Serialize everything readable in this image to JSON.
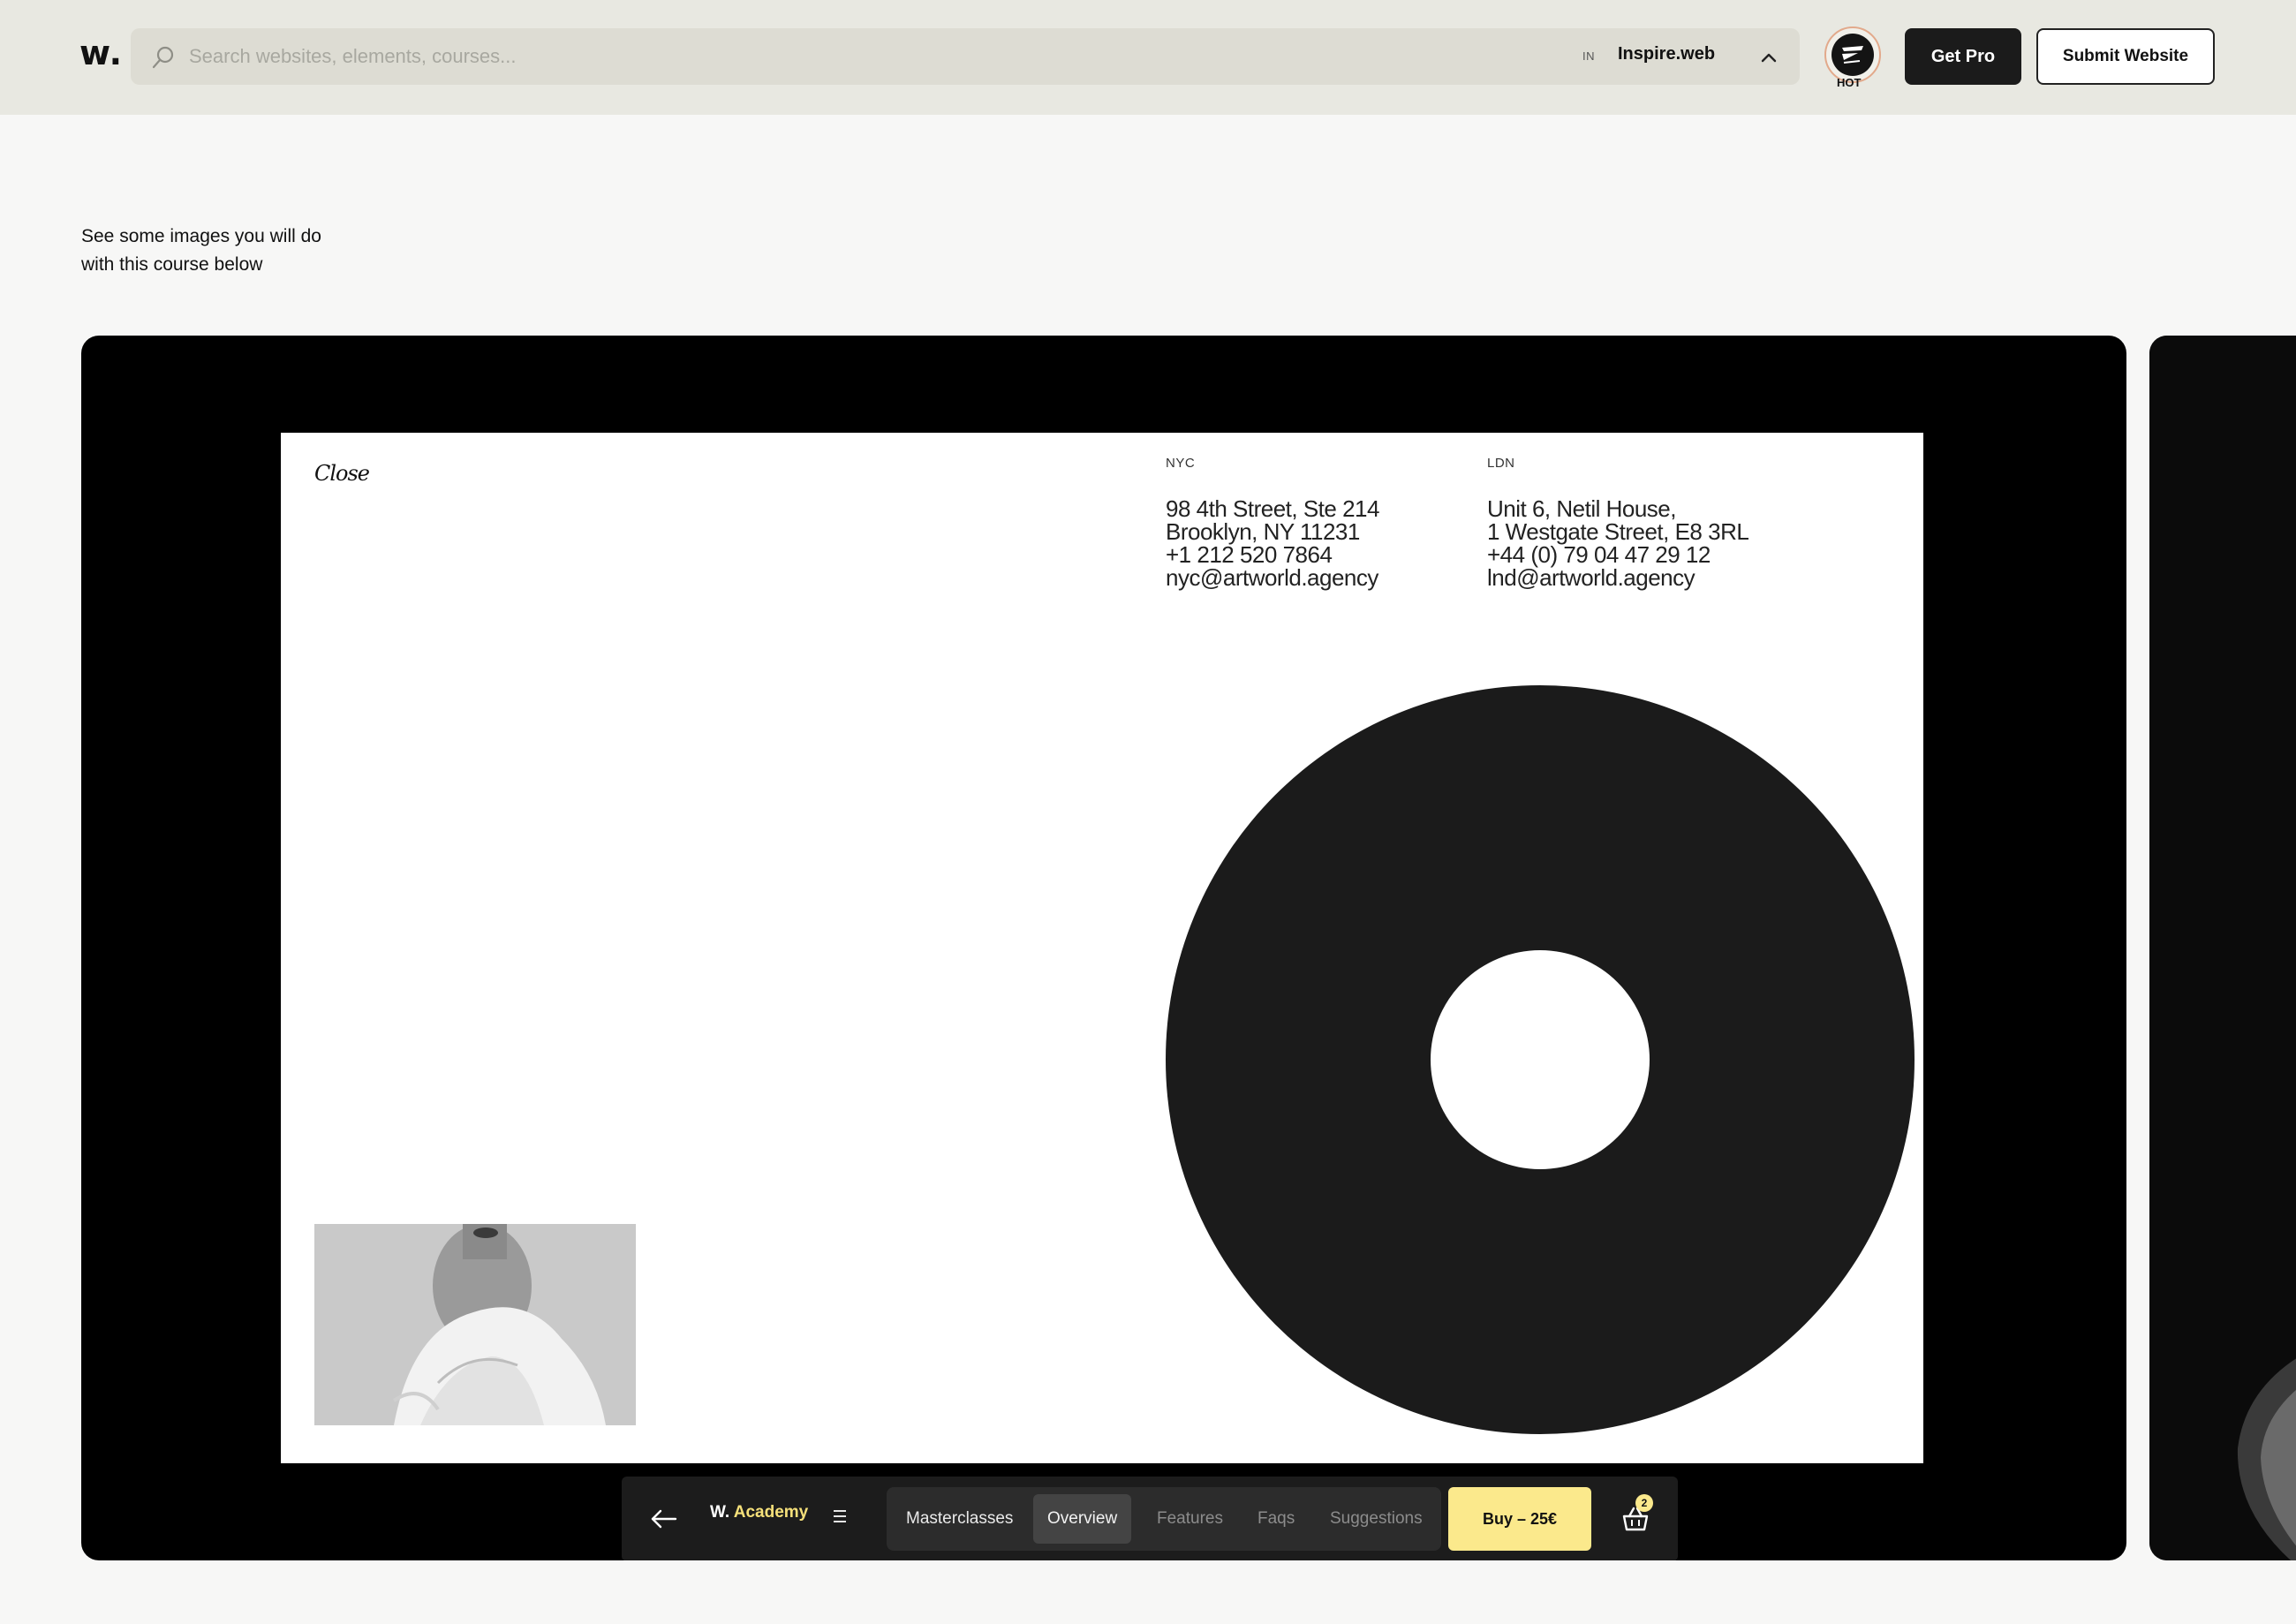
{
  "header": {
    "logo": "w.",
    "search": {
      "placeholder": "Search websites, elements, courses..."
    },
    "scope": {
      "prefix": "IN",
      "name": "Inspire.web"
    },
    "hot_badge": "HOT",
    "get_pro_label": "Get Pro",
    "submit_label": "Submit Website"
  },
  "intro": {
    "line1": "See some images you will do",
    "line2": "with this course below"
  },
  "slide": {
    "site_logo": "Close",
    "offices": [
      {
        "city": "NYC",
        "lines": [
          "98 4th Street, Ste 214",
          "Brooklyn, NY 11231",
          "+1 212 520 7864",
          "nyc@artworld.agency"
        ]
      },
      {
        "city": "LDN",
        "lines": [
          "Unit 6, Netil House,",
          "1 Westgate Street, E8 3RL",
          "+44 (0) 79 04 47 29 12",
          "lnd@artworld.agency"
        ]
      }
    ]
  },
  "nav": {
    "brand_w": "W.",
    "brand_name": "Academy",
    "tabs": [
      {
        "label": "Masterclasses"
      },
      {
        "label": "Overview",
        "active": true
      },
      {
        "label": "Features"
      },
      {
        "label": "Faqs"
      },
      {
        "label": "Suggestions"
      }
    ],
    "buy_label": "Buy – 25€",
    "cart_count": "2"
  },
  "colors": {
    "header_bg": "#e8e8e1",
    "search_bg": "#dddcd3",
    "page_bg": "#f7f7f6",
    "accent_yellow": "#fbe98c",
    "dark": "#1b1b1b"
  },
  "icons": {
    "search": "search-icon",
    "scope_chevron": "chevron-up-icon",
    "back": "arrow-left-icon",
    "menu": "hamburger-menu-icon",
    "cart": "basket-icon"
  }
}
